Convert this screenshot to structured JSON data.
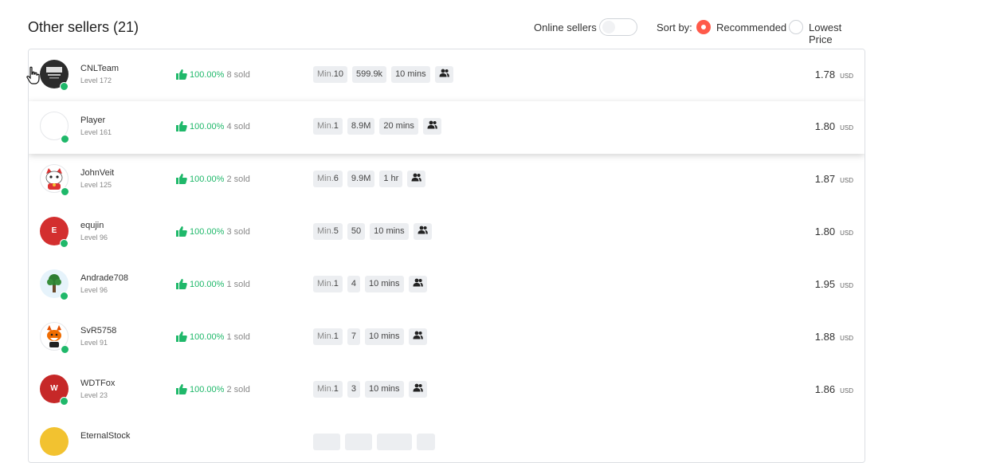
{
  "header": {
    "title": "Other sellers (21)",
    "online_label": "Online sellers",
    "sort_label": "Sort by:",
    "sort_options": [
      {
        "label": "Recommended",
        "selected": true
      },
      {
        "label": "Lowest Price",
        "selected": false
      }
    ]
  },
  "colors": {
    "accent": "#ff5a4a",
    "positive": "#1fb86a",
    "online": "#1fb86a"
  },
  "sellers": [
    {
      "name": "CNLTeam",
      "level": "Level 172",
      "rate": "100.00%",
      "sold": "8 sold",
      "min_label": "Min.",
      "min": "10",
      "stock": "599.9k",
      "time": "10 mins",
      "price": "1.78",
      "currency": "USD"
    },
    {
      "name": "Player",
      "level": "Level 161",
      "rate": "100.00%",
      "sold": "4 sold",
      "min_label": "Min.",
      "min": "1",
      "stock": "8.9M",
      "time": "20 mins",
      "price": "1.80",
      "currency": "USD"
    },
    {
      "name": "JohnVeit",
      "level": "Level 125",
      "rate": "100.00%",
      "sold": "2 sold",
      "min_label": "Min.",
      "min": "6",
      "stock": "9.9M",
      "time": "1 hr",
      "price": "1.87",
      "currency": "USD"
    },
    {
      "name": "equjin",
      "level": "Level 96",
      "rate": "100.00%",
      "sold": "3 sold",
      "min_label": "Min.",
      "min": "5",
      "stock": "50",
      "time": "10 mins",
      "price": "1.80",
      "currency": "USD",
      "initial": "E"
    },
    {
      "name": "Andrade708",
      "level": "Level 96",
      "rate": "100.00%",
      "sold": "1 sold",
      "min_label": "Min.",
      "min": "1",
      "stock": "4",
      "time": "10 mins",
      "price": "1.95",
      "currency": "USD"
    },
    {
      "name": "SvR5758",
      "level": "Level 91",
      "rate": "100.00%",
      "sold": "1 sold",
      "min_label": "Min.",
      "min": "1",
      "stock": "7",
      "time": "10 mins",
      "price": "1.88",
      "currency": "USD"
    },
    {
      "name": "WDTFox",
      "level": "Level 23",
      "rate": "100.00%",
      "sold": "2 sold",
      "min_label": "Min.",
      "min": "1",
      "stock": "3",
      "time": "10 mins",
      "price": "1.86",
      "currency": "USD",
      "initial": "W"
    },
    {
      "name": "EternalStock",
      "level": "",
      "rate": "",
      "sold": "",
      "min_label": "",
      "min": "",
      "stock": "",
      "time": "",
      "price": "",
      "currency": ""
    }
  ]
}
